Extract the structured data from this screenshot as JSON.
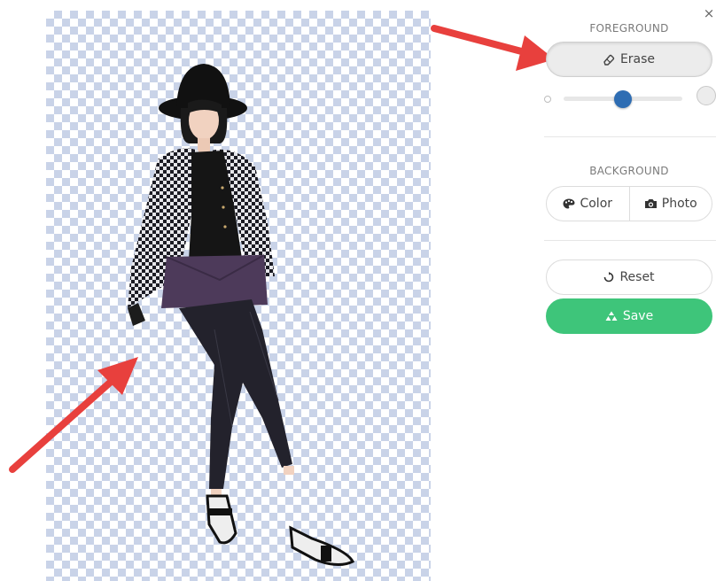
{
  "panel": {
    "close_glyph": "×",
    "foreground": {
      "title": "FOREGROUND",
      "erase_label": "Erase",
      "erase_icon": "eraser-icon",
      "brush_size": 0.5
    },
    "background": {
      "title": "BACKGROUND",
      "color_label": "Color",
      "color_icon": "palette-icon",
      "photo_label": "Photo",
      "photo_icon": "camera-icon"
    },
    "reset": {
      "label": "Reset",
      "icon": "reset-icon"
    },
    "save": {
      "label": "Save",
      "icon": "save-icon",
      "color": "#3ec57a"
    }
  },
  "canvas": {
    "background": "transparent-checkerboard"
  },
  "colors": {
    "accent": "#2e6db3",
    "arrow": "#e8403d"
  }
}
